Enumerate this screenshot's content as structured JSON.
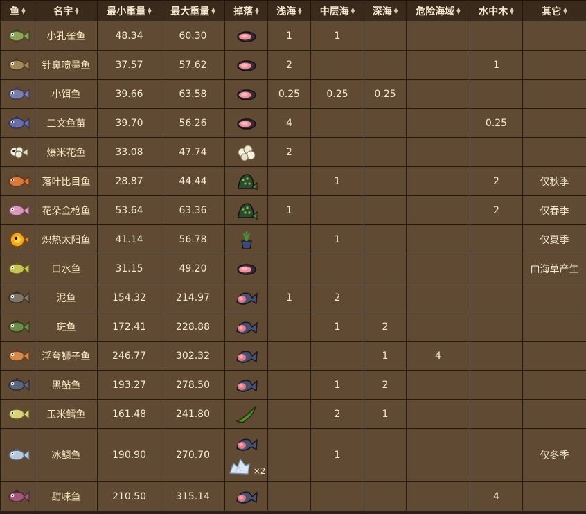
{
  "headers": [
    "鱼",
    "名字",
    "最小重量",
    "最大重量",
    "掉落",
    "浅海",
    "中层海",
    "深海",
    "危险海域",
    "水中木",
    "其它"
  ],
  "colors": {
    "header_bg": "#3a2a1b",
    "cell_bg": "#614a34",
    "border": "#241a11",
    "text": "#f4ead6"
  },
  "rows": [
    {
      "fish_icon": "small-fish-icon",
      "name": "小孔雀鱼",
      "min": "48.34",
      "max": "60.30",
      "drop_icon": "small-fish-meat-icon",
      "shallow": "1",
      "medium": "1",
      "deep": "",
      "hazard": "",
      "tree": "",
      "other": ""
    },
    {
      "fish_icon": "small-fish-icon",
      "name": "针鼻喷墨鱼",
      "min": "37.57",
      "max": "57.62",
      "drop_icon": "small-fish-meat-icon",
      "shallow": "2",
      "medium": "",
      "deep": "",
      "hazard": "",
      "tree": "1",
      "other": ""
    },
    {
      "fish_icon": "small-fish-icon",
      "name": "小饵鱼",
      "min": "39.66",
      "max": "63.58",
      "drop_icon": "small-fish-meat-icon",
      "shallow": "0.25",
      "medium": "0.25",
      "deep": "0.25",
      "hazard": "",
      "tree": "",
      "other": ""
    },
    {
      "fish_icon": "small-fish-icon",
      "name": "三文鱼苗",
      "min": "39.70",
      "max": "56.26",
      "drop_icon": "small-fish-meat-icon",
      "shallow": "4",
      "medium": "",
      "deep": "",
      "hazard": "",
      "tree": "0.25",
      "other": ""
    },
    {
      "fish_icon": "popcorn-fish-icon",
      "name": "爆米花鱼",
      "min": "33.08",
      "max": "47.74",
      "drop_icon": "popcorn-icon",
      "shallow": "2",
      "medium": "",
      "deep": "",
      "hazard": "",
      "tree": "",
      "other": ""
    },
    {
      "fish_icon": "small-fish-icon",
      "name": "落叶比目鱼",
      "min": "28.87",
      "max": "44.44",
      "drop_icon": "leaf-fish-meat-icon",
      "shallow": "",
      "medium": "1",
      "deep": "",
      "hazard": "",
      "tree": "2",
      "other": "仅秋季"
    },
    {
      "fish_icon": "small-fish-icon",
      "name": "花朵金枪鱼",
      "min": "53.64",
      "max": "63.36",
      "drop_icon": "leaf-fish-meat-icon",
      "shallow": "1",
      "medium": "",
      "deep": "",
      "hazard": "",
      "tree": "2",
      "other": "仅春季"
    },
    {
      "fish_icon": "sun-fish-icon",
      "name": "炽热太阳鱼",
      "min": "41.14",
      "max": "56.78",
      "drop_icon": "potted-plant-icon",
      "shallow": "",
      "medium": "1",
      "deep": "",
      "hazard": "",
      "tree": "",
      "other": "仅夏季"
    },
    {
      "fish_icon": "small-fish-icon",
      "name": "口水鱼",
      "min": "31.15",
      "max": "49.20",
      "drop_icon": "small-fish-meat-icon",
      "shallow": "",
      "medium": "",
      "deep": "",
      "hazard": "",
      "tree": "",
      "other": "由海草产生"
    },
    {
      "fish_icon": "large-fish-icon",
      "name": "泥鱼",
      "min": "154.32",
      "max": "214.97",
      "drop_icon": "fish-meat-icon",
      "shallow": "1",
      "medium": "2",
      "deep": "",
      "hazard": "",
      "tree": "",
      "other": ""
    },
    {
      "fish_icon": "large-fish-icon",
      "name": "斑鱼",
      "min": "172.41",
      "max": "228.88",
      "drop_icon": "fish-meat-icon",
      "shallow": "",
      "medium": "1",
      "deep": "2",
      "hazard": "",
      "tree": "",
      "other": ""
    },
    {
      "fish_icon": "large-fish-icon",
      "name": "浮夸狮子鱼",
      "min": "246.77",
      "max": "302.32",
      "drop_icon": "fish-meat-icon",
      "shallow": "",
      "medium": "",
      "deep": "1",
      "hazard": "4",
      "tree": "",
      "other": ""
    },
    {
      "fish_icon": "large-fish-icon",
      "name": "黑鲇鱼",
      "min": "193.27",
      "max": "278.50",
      "drop_icon": "fish-meat-icon",
      "shallow": "",
      "medium": "1",
      "deep": "2",
      "hazard": "",
      "tree": "",
      "other": ""
    },
    {
      "fish_icon": "large-fish-icon",
      "name": "玉米鳕鱼",
      "min": "161.48",
      "max": "241.80",
      "drop_icon": "corn-icon",
      "shallow": "",
      "medium": "2",
      "deep": "1",
      "hazard": "",
      "tree": "",
      "other": ""
    },
    {
      "fish_icon": "ice-fish-icon",
      "name": "冰鲷鱼",
      "min": "190.90",
      "max": "270.70",
      "drop_icon": "fish-meat-icon",
      "drop_icon2": "ice-icon",
      "drop2_text": "×2",
      "shallow": "",
      "medium": "1",
      "deep": "",
      "hazard": "",
      "tree": "",
      "other": "仅冬季"
    },
    {
      "fish_icon": "sweet-fish-icon",
      "name": "甜味鱼",
      "min": "210.50",
      "max": "315.14",
      "drop_icon": "fish-meat-icon",
      "shallow": "",
      "medium": "",
      "deep": "",
      "hazard": "",
      "tree": "4",
      "other": ""
    }
  ]
}
